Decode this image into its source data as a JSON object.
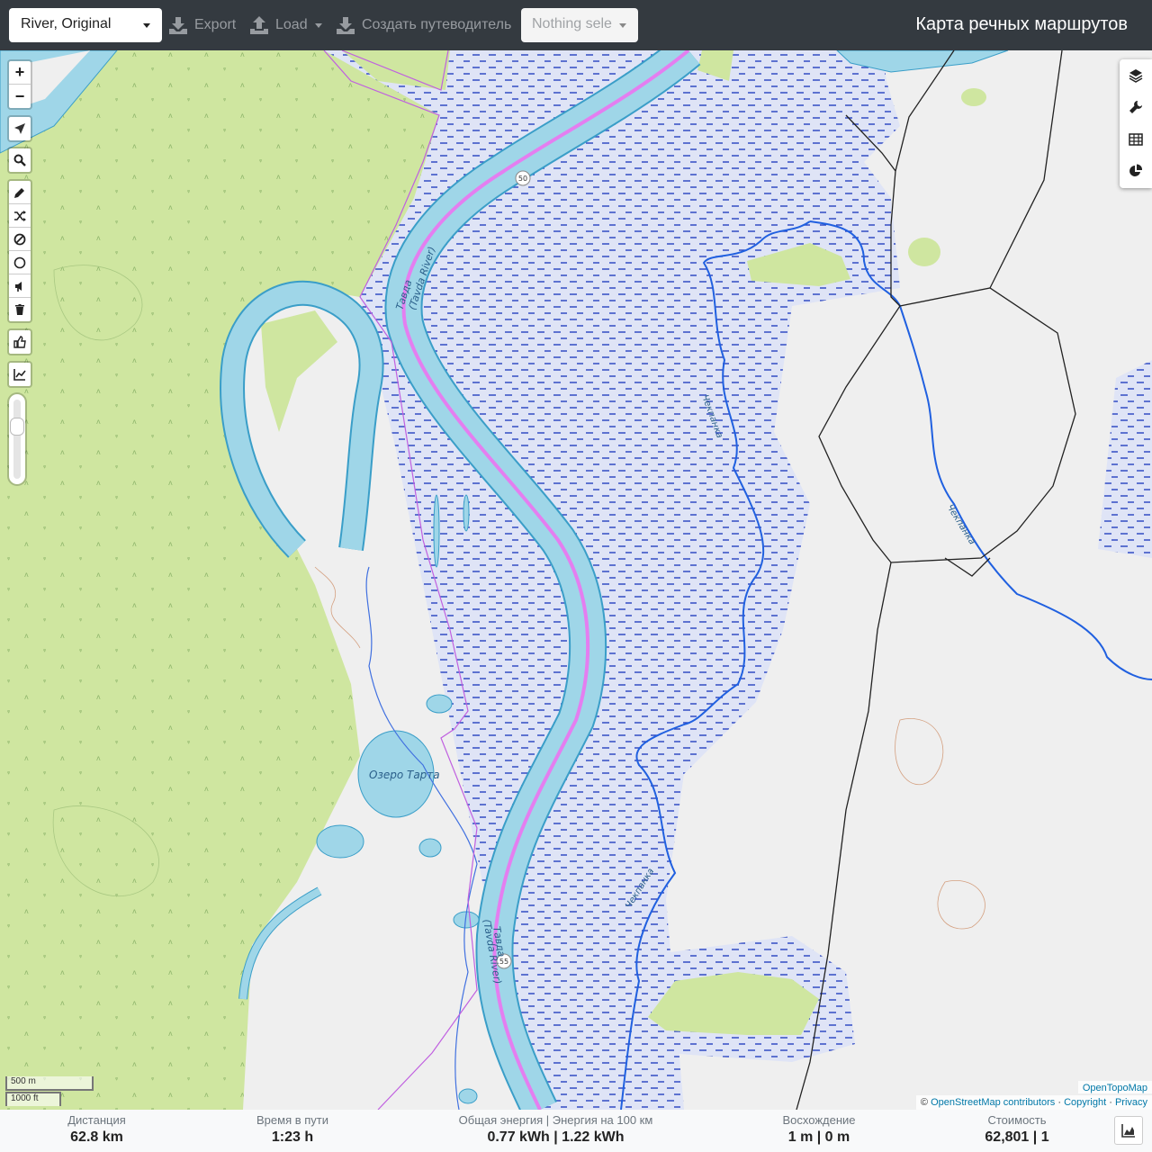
{
  "toolbar": {
    "profile": "River, Original",
    "export_label": "Export",
    "load_label": "Load",
    "guide_label": "Создать путеводитель",
    "selection_placeholder": "Nothing selected",
    "selection_visible": "Nothing sele",
    "title": "Карта речных маршрутов"
  },
  "map": {
    "labels": {
      "river_tavda_1": "Тавда",
      "river_tavda_1b": "(Tavda River)",
      "river_tavda_2": "Тавда",
      "river_tavda_2b": "(Tavda River)",
      "lake": "Озеро Тарта",
      "stream_1": "Чекпанка",
      "stream_2": "Чекпанка",
      "stream_3": "Чекпанка",
      "km_50": "50",
      "km_55": "55"
    },
    "left_controls": {
      "zoom_in": "+",
      "zoom_out": "−"
    },
    "right_controls": [
      "layers-icon",
      "wrench-icon",
      "table-icon",
      "pie-chart-icon"
    ],
    "scale": {
      "metric": "500 m",
      "imperial": "1000 ft"
    },
    "attribution": {
      "provider": "OpenTopoMap",
      "prefix": "©",
      "osm": "OpenStreetMap contributors",
      "sep1": "·",
      "copyright": "Copyright",
      "sep2": "·",
      "privacy": "Privacy"
    },
    "colors": {
      "forest": "#cfe6a0",
      "wetland": "#dde3f6",
      "river": "#9fd6e8",
      "route": "#e47ef0",
      "stream": "#2060e0"
    }
  },
  "stats": {
    "distance_label": "Дистанция",
    "distance_value": "62.8 km",
    "time_label": "Время в пути",
    "time_value": "1:23 h",
    "energy_label": "Общая энергия | Энергия на 100 км",
    "energy_value": "0.77 kWh | 1.22 kWh",
    "ascent_label": "Восхождение",
    "ascent_value": "1 m | 0 m",
    "cost_label": "Стоимость",
    "cost_value": "62,801 | 1"
  }
}
